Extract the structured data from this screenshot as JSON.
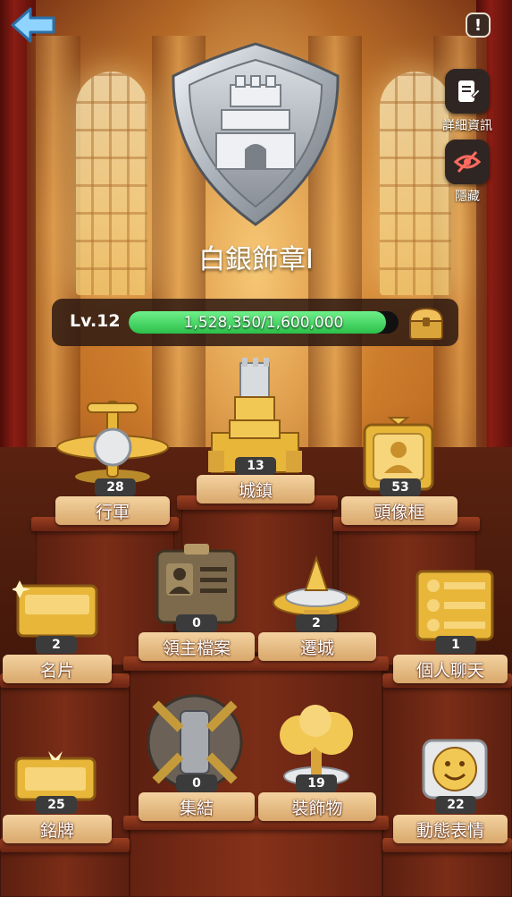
{
  "badge": {
    "name": "白銀飾章I"
  },
  "side_buttons": {
    "details_label": "詳細資訊",
    "hide_label": "隱藏"
  },
  "level": {
    "label": "Lv.12",
    "progress_text": "1,528,350/1,600,000",
    "progress_fraction": 0.955
  },
  "categories": [
    {
      "label": "行軍",
      "count": "28"
    },
    {
      "label": "城鎮",
      "count": "13"
    },
    {
      "label": "頭像框",
      "count": "53"
    },
    {
      "label": "名片",
      "count": "2"
    },
    {
      "label": "領主檔案",
      "count": "0"
    },
    {
      "label": "遷城",
      "count": "2"
    },
    {
      "label": "個人聊天",
      "count": "1"
    },
    {
      "label": "銘牌",
      "count": "25"
    },
    {
      "label": "集結",
      "count": "0"
    },
    {
      "label": "裝飾物",
      "count": "19"
    },
    {
      "label": "動態表情",
      "count": "22"
    }
  ],
  "colors": {
    "accent_green": "#2cbf4a",
    "gold": "#e8b73a",
    "wood": "#7a2d17"
  }
}
